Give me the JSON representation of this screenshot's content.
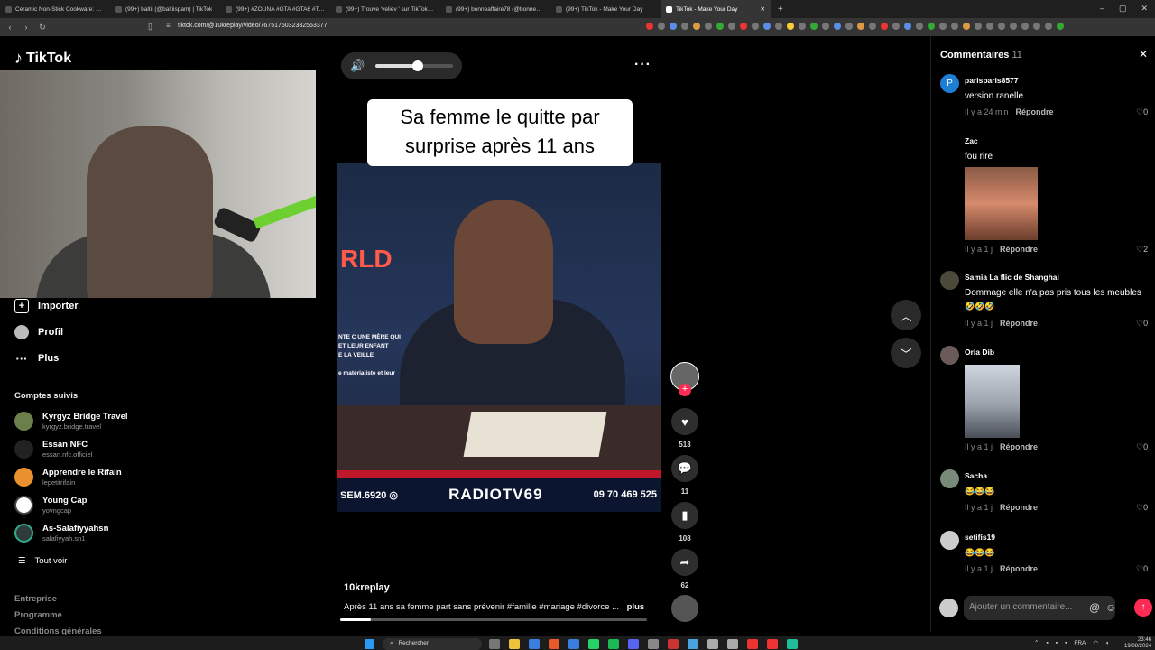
{
  "browser": {
    "tabs": [
      {
        "title": "Ceramic Non-Stick Cookware: Non-T...",
        "active": false
      },
      {
        "title": "(99+) baltii (@baltiispam) | TikTok",
        "active": false
      },
      {
        "title": "(99+) #ZOUNA #GTA #GTA6 #TRAIL...",
        "active": false
      },
      {
        "title": "(99+) Trouve 'veliev ' sur TikTok | Rec...",
        "active": false
      },
      {
        "title": "(99+) bonneaffaire78 (@bonneaffaire...",
        "active": false
      },
      {
        "title": "(99+) TikTok - Make Your Day",
        "active": false
      },
      {
        "title": "TikTok - Make Your Day",
        "active": true
      }
    ],
    "url": "tiktok.com/@10kreplay/video/7675176032382553377",
    "window_controls": [
      "–",
      "▢",
      "✕"
    ]
  },
  "sidebar": {
    "logo": "TikTok",
    "nav": [
      {
        "label": "Importer",
        "icon": "upload-icon"
      },
      {
        "label": "Profil",
        "icon": "profile-icon"
      },
      {
        "label": "Plus",
        "icon": "more-icon"
      }
    ],
    "following_title": "Comptes suivis",
    "following": [
      {
        "name": "Kyrgyz Bridge Travel",
        "handle": "kyrgyz.bridge.travel"
      },
      {
        "name": "Essan NFC",
        "handle": "essan.nfc.officiel"
      },
      {
        "name": "Apprendre le Rifain",
        "handle": "lepetitrifain"
      },
      {
        "name": "Young Cap",
        "handle": "yovngcap"
      },
      {
        "name": "As-Salafiyyahsn",
        "handle": "salafiyyah.sn1"
      }
    ],
    "see_all": "Tout voir",
    "footer": [
      "Entreprise",
      "Programme",
      "Conditions générales"
    ]
  },
  "video": {
    "volume_level": 0.55,
    "caption": "Sa femme le quitte par\nsurprise après 11 ans",
    "overlay_text": "NTE C UNE MÈRE QUI\nET LEUR ENFANT\nE LA VEILLE\n\ne matérialiste et leur",
    "banner_left": "SEM.6920 ◎",
    "banner_mid": "RADIOTV69",
    "banner_right": "09 70 469 525",
    "neon": "RLD",
    "author": "10kreplay",
    "description": "Après 11 ans sa femme part sans prévenir #famille #mariage #divorce ...",
    "more_label": "plus",
    "progress": 0.1
  },
  "actions": {
    "likes": "513",
    "comments": "11",
    "saves": "108",
    "shares": "62"
  },
  "comments": {
    "title": "Commentaires",
    "count": "11",
    "reply_label": "Répondre",
    "items": [
      {
        "user": "parisparis8577",
        "avatar_letter": "P",
        "text": "version ranelle",
        "time": "Il y a 24 min",
        "likes": "0"
      },
      {
        "user": "Zac",
        "avatar_letter": "",
        "text": "fou rire",
        "time": "Il y a 1 j",
        "likes": "2"
      },
      {
        "user": "Samia La flic de Shanghai",
        "avatar_letter": "",
        "text": "Dommage elle n'a pas pris tous les meubles",
        "emoji": "🤣🤣🤣",
        "time": "Il y a 1 j",
        "likes": "0"
      },
      {
        "user": "Oria Dib",
        "avatar_letter": "",
        "text": "",
        "time": "Il y a 1 j",
        "likes": "0"
      },
      {
        "user": "Sacha",
        "avatar_letter": "",
        "text": "😂😂😂",
        "time": "Il y a 1 j",
        "likes": "0"
      },
      {
        "user": "setifis19",
        "avatar_letter": "",
        "text": "😂😂😂",
        "time": "Il y a 1 j",
        "likes": "0"
      }
    ],
    "input_placeholder": "Ajouter un commentaire..."
  },
  "taskbar": {
    "search": "Rechercher",
    "lang": "FRA",
    "time": "23:46",
    "date": "19/08/2024"
  }
}
